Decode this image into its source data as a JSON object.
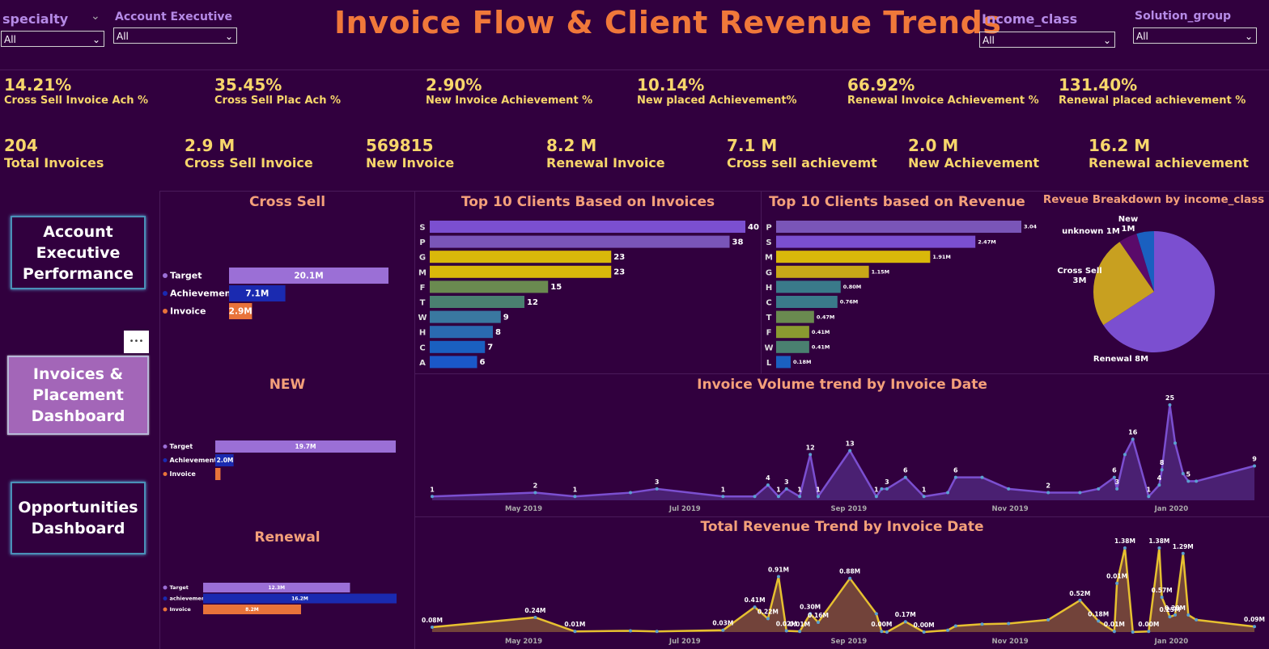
{
  "title": "Invoice Flow & Client Revenue Trends",
  "slicers": [
    {
      "label": "specialty",
      "value": "All"
    },
    {
      "label": "Account Executive",
      "value": "All"
    },
    {
      "label": "Income_class",
      "value": "All"
    },
    {
      "label": "Solution_group",
      "value": "All"
    }
  ],
  "kpis_row1": [
    {
      "value": "14.21%",
      "label": "Cross Sell Invoice Ach %"
    },
    {
      "value": "35.45%",
      "label": "Cross Sell Plac Ach %"
    },
    {
      "value": "2.90%",
      "label": "New Invoice Achievement %"
    },
    {
      "value": "10.14%",
      "label": "New placed Achievement%"
    },
    {
      "value": "66.92%",
      "label": "Renewal Invoice Achievement %"
    },
    {
      "value": "131.40%",
      "label": "Renewal placed achievement %"
    }
  ],
  "kpis_row2": [
    {
      "value": "204",
      "label": "Total Invoices"
    },
    {
      "value": "2.9 M",
      "label": "Cross Sell Invoice"
    },
    {
      "value": "569815",
      "label": "New Invoice"
    },
    {
      "value": "8.2 M",
      "label": "Renewal Invoice"
    },
    {
      "value": "7.1 M",
      "label": "Cross sell achievemt"
    },
    {
      "value": "2.0 M",
      "label": "New Achievement"
    },
    {
      "value": "16.2 M",
      "label": "Renewal achievement"
    }
  ],
  "nav": {
    "account": "Account Executive Performance",
    "invoices": "Invoices & Placement Dashboard",
    "opportunities": "Opportunities Dashboard",
    "more": "•••"
  },
  "colors": {
    "target": "#9b6fd6",
    "achievement": "#1a2ab0",
    "invoice": "#e8733a",
    "title": "#f0783a",
    "kpi": "#f7d66b"
  },
  "chart_data": [
    {
      "id": "cross_sell",
      "type": "bar",
      "title": "Cross Sell",
      "categories": [
        "Target",
        "Achievement",
        "Invoice"
      ],
      "values": [
        20.1,
        7.1,
        2.9
      ],
      "labels": [
        "20.1M",
        "7.1M",
        "2.9M"
      ]
    },
    {
      "id": "new",
      "type": "bar",
      "title": "NEW",
      "categories": [
        "Target",
        "Achievement",
        "Invoice"
      ],
      "values": [
        19.7,
        2.0,
        0.57
      ],
      "labels": [
        "19.7M",
        "2.0M",
        ""
      ]
    },
    {
      "id": "renewal",
      "type": "bar",
      "title": "Renewal",
      "categories": [
        "Target",
        "achievement",
        "Invoice"
      ],
      "values": [
        12.3,
        16.2,
        8.2
      ],
      "labels": [
        "12.3M",
        "16.2M",
        "8.2M"
      ]
    },
    {
      "id": "top_invoices",
      "type": "bar",
      "title": "Top 10 Clients Based on Invoices",
      "categories": [
        "S",
        "P",
        "G",
        "M",
        "F",
        "T",
        "W",
        "H",
        "C",
        "A"
      ],
      "values": [
        40,
        38,
        23,
        23,
        15,
        12,
        9,
        8,
        7,
        6
      ],
      "bar_colors": [
        "#7b4fd0",
        "#7a55b8",
        "#d9b80a",
        "#d9b80a",
        "#6a8a50",
        "#4a8070",
        "#3a78a0",
        "#2a6ab0",
        "#1a60c0",
        "#1a58c8"
      ]
    },
    {
      "id": "top_revenue",
      "type": "bar",
      "title": "Top 10 Clients based on Revenue",
      "categories": [
        "P",
        "S",
        "M",
        "G",
        "H",
        "C",
        "T",
        "F",
        "W",
        "L"
      ],
      "values": [
        3.04,
        2.47,
        1.91,
        1.15,
        0.8,
        0.76,
        0.47,
        0.41,
        0.41,
        0.18
      ],
      "labels": [
        "3.04M",
        "2.47M",
        "1.91M",
        "1.15M",
        "0.80M",
        "0.76M",
        "0.47M",
        "0.41M",
        "0.41M",
        "0.18M"
      ],
      "bar_colors": [
        "#7a55b8",
        "#7b4fd0",
        "#d9b80a",
        "#c8a818",
        "#3a7a8a",
        "#3a7a8a",
        "#6a8a50",
        "#8a9a30",
        "#4a8070",
        "#1a60c0"
      ]
    },
    {
      "id": "income_pie",
      "type": "pie",
      "title": "Reveue Breakdown by income_class",
      "slices": [
        {
          "name": "Renewal",
          "label": "Renewal 8M",
          "value": 8,
          "color": "#7b4fd0"
        },
        {
          "name": "Cross Sell",
          "label": "Cross Sell 3M",
          "value": 3,
          "color": "#c8a020"
        },
        {
          "name": "unknown",
          "label": "unknown 1M",
          "value": 0.6,
          "color": "#5a0a6a"
        },
        {
          "name": "New",
          "label": "New 1M",
          "value": 0.57,
          "color": "#1a60c0"
        }
      ]
    },
    {
      "id": "volume_trend",
      "type": "area",
      "title": "Invoice Volume trend by Invoice Date",
      "x_ticks": [
        "May 2019",
        "Jul 2019",
        "Sep 2019",
        "Nov 2019",
        "Jan 2020"
      ],
      "x": [
        "2019-04-01",
        "2019-05-10",
        "2019-05-25",
        "2019-06-15",
        "2019-06-25",
        "2019-07-20",
        "2019-08-01",
        "2019-08-06",
        "2019-08-10",
        "2019-08-13",
        "2019-08-18",
        "2019-08-22",
        "2019-08-25",
        "2019-09-06",
        "2019-09-16",
        "2019-09-18",
        "2019-09-20",
        "2019-09-27",
        "2019-10-04",
        "2019-10-13",
        "2019-10-16",
        "2019-10-26",
        "2019-11-05",
        "2019-11-20",
        "2019-12-02",
        "2019-12-09",
        "2019-12-15",
        "2019-12-16",
        "2019-12-19",
        "2019-12-22",
        "2019-12-28",
        "2020-01-01",
        "2020-01-02",
        "2020-01-05",
        "2020-01-07",
        "2020-01-10",
        "2020-01-12",
        "2020-01-15",
        "2020-02-06"
      ],
      "values": [
        1,
        2,
        1,
        2,
        3,
        1,
        1,
        4,
        1,
        3,
        1,
        12,
        1,
        13,
        1,
        3,
        3,
        6,
        1,
        2,
        6,
        6,
        3,
        2,
        2,
        3,
        6,
        3,
        12,
        16,
        1,
        4,
        8,
        25,
        15,
        7,
        5,
        5,
        9
      ],
      "point_labels": [
        "1",
        "2",
        "1",
        "",
        "3",
        "1",
        "",
        "4",
        "1",
        "3",
        "1",
        "12",
        "1",
        "13",
        "1",
        "",
        "3",
        "6",
        "1",
        "",
        "6",
        "",
        "",
        "2",
        "",
        "",
        "6",
        "3",
        "",
        "16",
        "1",
        "4",
        "8",
        "25",
        "",
        "",
        "5",
        "",
        "9"
      ],
      "color": "#7b4fd0"
    },
    {
      "id": "revenue_trend",
      "type": "area",
      "title": "Total Revenue Trend by Invoice Date",
      "x_ticks": [
        "May 2019",
        "Jul 2019",
        "Sep 2019",
        "Nov 2019",
        "Jan 2020"
      ],
      "x": [
        "2019-04-01",
        "2019-05-10",
        "2019-05-25",
        "2019-06-15",
        "2019-06-25",
        "2019-07-20",
        "2019-08-01",
        "2019-08-06",
        "2019-08-10",
        "2019-08-13",
        "2019-08-18",
        "2019-08-22",
        "2019-08-25",
        "2019-09-06",
        "2019-09-16",
        "2019-09-18",
        "2019-09-20",
        "2019-09-27",
        "2019-10-04",
        "2019-10-13",
        "2019-10-16",
        "2019-10-26",
        "2019-11-05",
        "2019-11-20",
        "2019-12-02",
        "2019-12-09",
        "2019-12-15",
        "2019-12-16",
        "2019-12-19",
        "2019-12-22",
        "2019-12-28",
        "2020-01-01",
        "2020-01-02",
        "2020-01-05",
        "2020-01-07",
        "2020-01-10",
        "2020-01-12",
        "2020-01-15",
        "2020-02-06"
      ],
      "values": [
        0.08,
        0.24,
        0.01,
        0.02,
        0.01,
        0.03,
        0.41,
        0.22,
        0.91,
        0.02,
        0.01,
        0.3,
        0.16,
        0.88,
        0.3,
        0.01,
        0.0,
        0.17,
        0.0,
        0.03,
        0.1,
        0.13,
        0.14,
        0.2,
        0.52,
        0.18,
        0.01,
        0.8,
        1.38,
        0.0,
        0.01,
        1.38,
        0.57,
        0.25,
        0.28,
        1.29,
        0.28,
        0.2,
        0.09
      ],
      "point_labels": [
        "0.08M",
        "0.24M",
        "0.01M",
        "",
        "",
        "0.03M",
        "0.41M",
        "0.22M",
        "0.91M",
        "0.02M",
        "0.01M",
        "0.30M",
        "0.16M",
        "0.88M",
        "",
        "0.00M",
        "",
        "0.17M",
        "0.00M",
        "",
        "",
        "",
        "",
        "",
        "0.52M",
        "0.18M",
        "0.01M",
        "0.01M",
        "1.38M",
        "",
        "0.00M",
        "1.38M",
        "0.57M",
        "0.25M",
        "0.28M",
        "1.29M",
        "",
        "",
        "0.09M"
      ],
      "color": "#e6c030"
    }
  ]
}
